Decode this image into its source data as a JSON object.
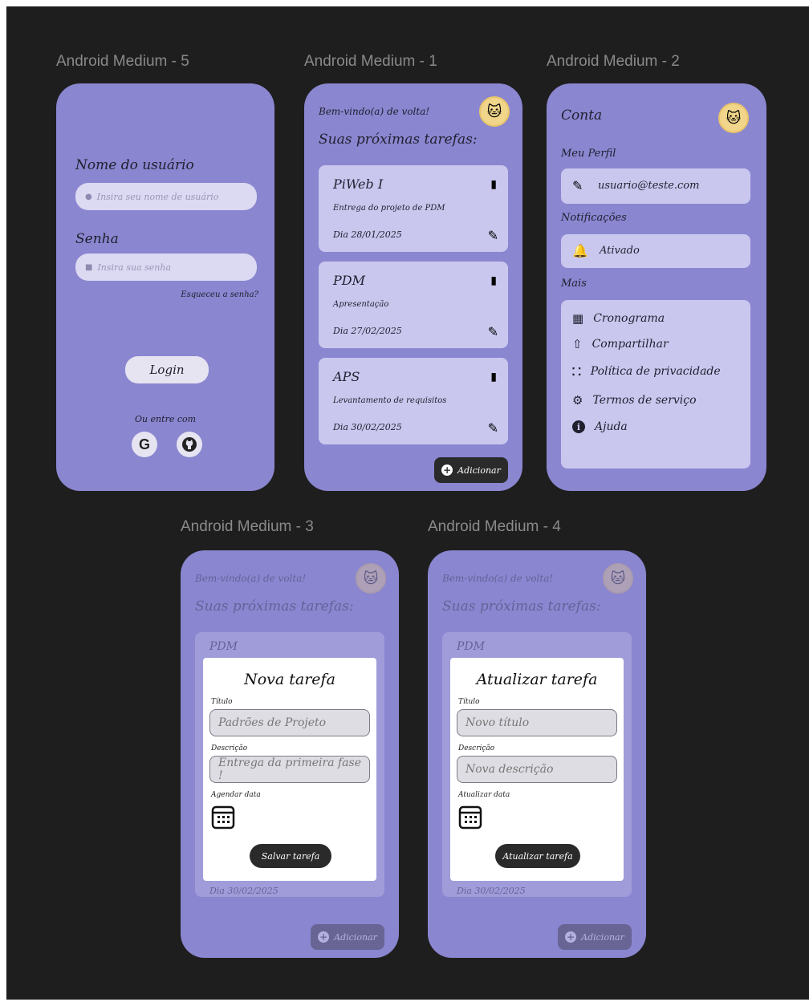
{
  "frames": {
    "login_label": "Android Medium - 5",
    "home_label": "Android Medium - 1",
    "account_label": "Android Medium - 2",
    "new_task_label": "Android Medium - 3",
    "update_task_label": "Android Medium - 4"
  },
  "login": {
    "username_label": "Nome do usuário",
    "username_placeholder": "Insira seu nome de usuário",
    "password_label": "Senha",
    "password_placeholder": "Insira sua senha",
    "forgot_password": "Esqueceu a senha?",
    "login_button": "Login",
    "or_enter_with": "Ou entre com",
    "google_label": "G"
  },
  "home": {
    "welcome": "Bem-vindo(a) de volta!",
    "subtitle": "Suas próximas tarefas:",
    "tasks": [
      {
        "title": "PiWeb I",
        "description": "Entrega do projeto de PDM",
        "date": "Dia 28/01/2025"
      },
      {
        "title": "PDM",
        "description": "Apresentação",
        "date": "Dia 27/02/2025"
      },
      {
        "title": "APS",
        "description": "Levantamento de requisitos",
        "date": "Dia 30/02/2025"
      }
    ],
    "add_button": "Adicionar"
  },
  "account": {
    "title": "Conta",
    "profile_label": "Meu Perfil",
    "email": "usuario@teste.com",
    "notifications_label": "Notificações",
    "notifications_value": "Ativado",
    "more_label": "Mais",
    "more_items": [
      "Cronograma",
      "Compartilhar",
      "Política de privacidade",
      "Termos de serviço",
      "Ajuda"
    ]
  },
  "new_task": {
    "bg_welcome": "Bem-vindo(a) de volta!",
    "bg_subtitle": "Suas próximas tarefas:",
    "bg_task_title": "PDM",
    "bg_task_date": "Dia 30/02/2025",
    "bg_add": "Adicionar",
    "modal_title": "Nova tarefa",
    "title_label": "Título",
    "title_value": "Padrões de Projeto",
    "description_label": "Descrição",
    "description_value": "Entrega da primeira fase !",
    "date_label": "Agendar data",
    "save_button": "Salvar tarefa"
  },
  "update_task": {
    "bg_welcome": "Bem-vindo(a) de volta!",
    "bg_subtitle": "Suas próximas tarefas:",
    "bg_task_title": "PDM",
    "bg_task_date": "Dia 30/02/2025",
    "bg_add": "Adicionar",
    "modal_title": "Atualizar tarefa",
    "title_label": "Título",
    "title_placeholder": "Novo título",
    "description_label": "Descrição",
    "description_placeholder": "Nova descrição",
    "date_label": "Atualizar data",
    "update_button": "Atualizar tarefa"
  },
  "colors": {
    "canvas": "#1e1e1e",
    "phone": "#8a86d0",
    "card": "#c9c7ee",
    "dark_button": "#2a2a2a"
  }
}
